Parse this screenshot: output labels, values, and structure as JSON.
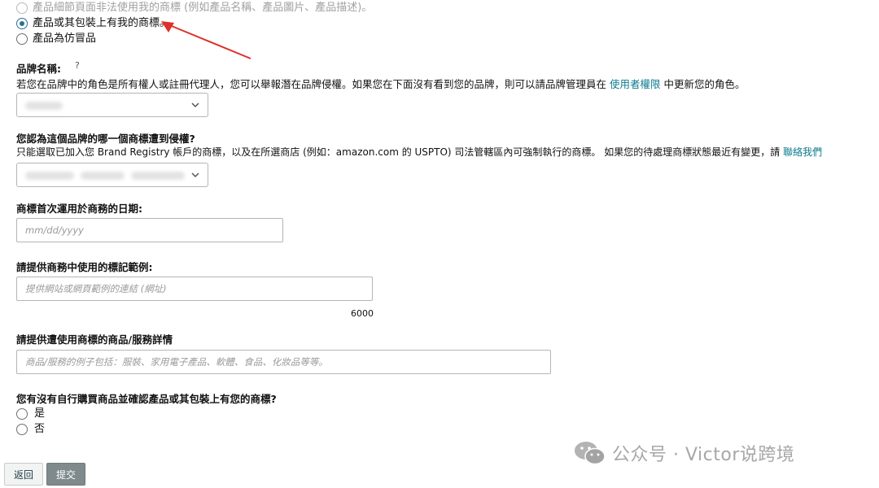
{
  "options": {
    "opt1": "產品細節頁面非法使用我的商標 (例如產品名稱、產品圖片、產品描述)。",
    "opt2": "產品或其包裝上有我的商標。",
    "opt3": "產品為仿冒品"
  },
  "brand": {
    "label": "品牌名稱:",
    "help_icon": "?",
    "help_text_pre": "若您在品牌中的角色是所有權人或註冊代理人，您可以舉報潛在品牌侵權。如果您在下面沒有看到您的品牌，則可以請品牌管理員在",
    "help_link": "使用者權限",
    "help_text_post": "中更新您的角色。"
  },
  "trademark": {
    "label": "您認為這個品牌的哪一個商標遭到侵權?",
    "help_text_pre": "只能選取已加入您 Brand Registry 帳戶的商標，以及在所選商店 (例如：amazon.com 的 USPTO) 司法管轄區內可強制執行的商標。 如果您的待處理商標狀態最近有變更，請",
    "help_link": "聯絡我們"
  },
  "first_use": {
    "label": "商標首次運用於商務的日期:",
    "placeholder": "mm/dd/yyyy"
  },
  "example": {
    "label": "請提供商務中使用的標記範例:",
    "placeholder": "提供網站或網頁範例的連結 (網址)",
    "counter": "6000"
  },
  "goods": {
    "label": "請提供遭使用商標的商品/服務詳情",
    "placeholder": "商品/服務的例子包括：服裝、家用電子產品、軟體、食品、化妝品等等。"
  },
  "purchase": {
    "label": "您有沒有自行購買商品並確認產品或其包裝上有您的商標?",
    "yes": "是",
    "no": "否"
  },
  "buttons": {
    "back": "返回",
    "submit": "提交"
  },
  "watermark": "公众号 · Victor说跨境",
  "colors": {
    "link": "#0b7a8f",
    "arrow": "#e0302a",
    "radio_checked": "#2f6f8f"
  }
}
